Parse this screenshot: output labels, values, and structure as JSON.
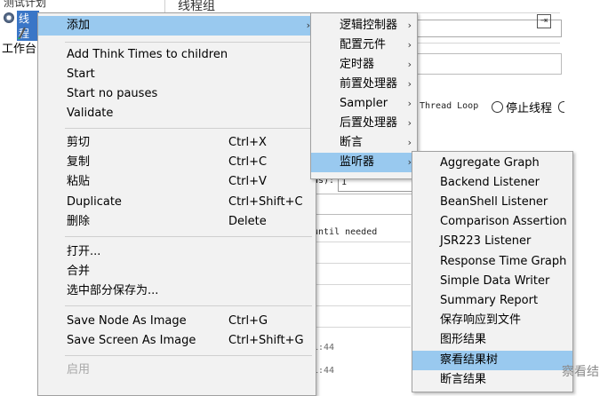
{
  "background": {
    "tree_header": "测试计划",
    "tree_item1": "线程",
    "tree_item2": "工作台",
    "panel_title": "线程组",
    "thread_loop": "Thread Loop",
    "stop_thread": "停止线程",
    "ds_label": "ds):",
    "ds_value": "1",
    "until_needed": "until needed",
    "time1": "1:44",
    "time2": "1:44"
  },
  "context_menu": {
    "add": "添加",
    "add_think_times": "Add Think Times to children",
    "start": "Start",
    "start_no_pauses": "Start no pauses",
    "validate": "Validate",
    "cut": "剪切",
    "cut_sc": "Ctrl+X",
    "copy": "复制",
    "copy_sc": "Ctrl+C",
    "paste": "粘贴",
    "paste_sc": "Ctrl+V",
    "duplicate": "Duplicate",
    "duplicate_sc": "Ctrl+Shift+C",
    "delete": "删除",
    "delete_sc": "Delete",
    "open": "打开...",
    "merge": "合并",
    "save_selection": "选中部分保存为...",
    "save_node_image": "Save Node As Image",
    "save_node_image_sc": "Ctrl+G",
    "save_screen_image": "Save Screen As Image",
    "save_screen_image_sc": "Ctrl+Shift+G",
    "enable": "启用"
  },
  "add_submenu": {
    "items": [
      "逻辑控制器",
      "配置元件",
      "定时器",
      "前置处理器",
      "Sampler",
      "后置处理器",
      "断言",
      "监听器"
    ]
  },
  "listener_submenu": {
    "items": [
      "Aggregate Graph",
      "Backend Listener",
      "BeanShell Listener",
      "Comparison Assertion",
      "JSR223 Listener",
      "Response Time Graph",
      "Simple Data Writer",
      "Summary Report",
      "保存响应到文件",
      "图形结果",
      "察看结果树",
      "断言结果"
    ]
  },
  "watermark": "察看结",
  "colors": {
    "highlight": "#99c9ef",
    "menu_bg": "#f2f2f2"
  }
}
